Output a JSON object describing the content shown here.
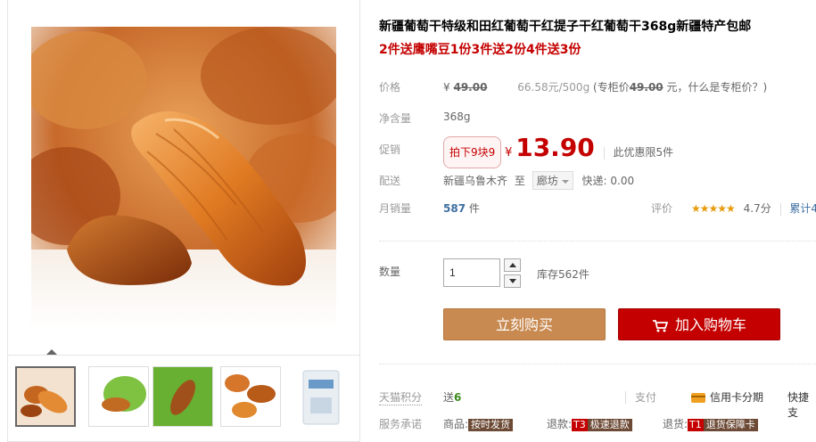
{
  "product": {
    "title": "新疆葡萄干特级和田红葡萄干红提子干红葡萄干368g新疆特产包邮",
    "promo": "2件送鹰嘴豆1份3件送2份4件送3份"
  },
  "price": {
    "label": "价格",
    "yen": "¥",
    "original": "49.00",
    "unit_price": "66.58元/500g",
    "counter_open": "(专柜价",
    "counter_value": "49.00",
    "counter_close": "元，什么是专柜价？)"
  },
  "weight": {
    "label": "净含量",
    "value": "368g"
  },
  "sale": {
    "label": "促销",
    "tag": "拍下9块9",
    "yen": "¥",
    "price": "13.90",
    "limit": "此优惠限5件"
  },
  "shipping": {
    "label": "配送",
    "from": "新疆乌鲁木齐",
    "to_word": "至",
    "destination": "廊坊",
    "express": "快递: 0.00"
  },
  "sales": {
    "label": "月销量",
    "count": "587",
    "unit": "件",
    "rating_label": "评价",
    "stars": "★★★★★",
    "score": "4.7分",
    "total": "累计4"
  },
  "quantity": {
    "label": "数量",
    "value": "1",
    "stock": "库存562件"
  },
  "buttons": {
    "buy": "立刻购买",
    "cart": "加入购物车"
  },
  "points": {
    "label": "天猫积分",
    "prefix": "送",
    "value": "6",
    "pay_label": "支付",
    "credit": "信用卡分期",
    "fast": "快捷支"
  },
  "service": {
    "label": "服务承诺",
    "goods_label": "商品:",
    "goods_badge": "按时发货",
    "refund_label": "退款:",
    "refund_code": "T3",
    "refund_badge": "极速退款",
    "return_label": "退货:",
    "return_code": "T1",
    "return_badge": "退货保障卡"
  },
  "colors": {
    "accent_red": "#c40000",
    "buy_button": "#c88a51",
    "link_blue": "#3d6ea0"
  }
}
